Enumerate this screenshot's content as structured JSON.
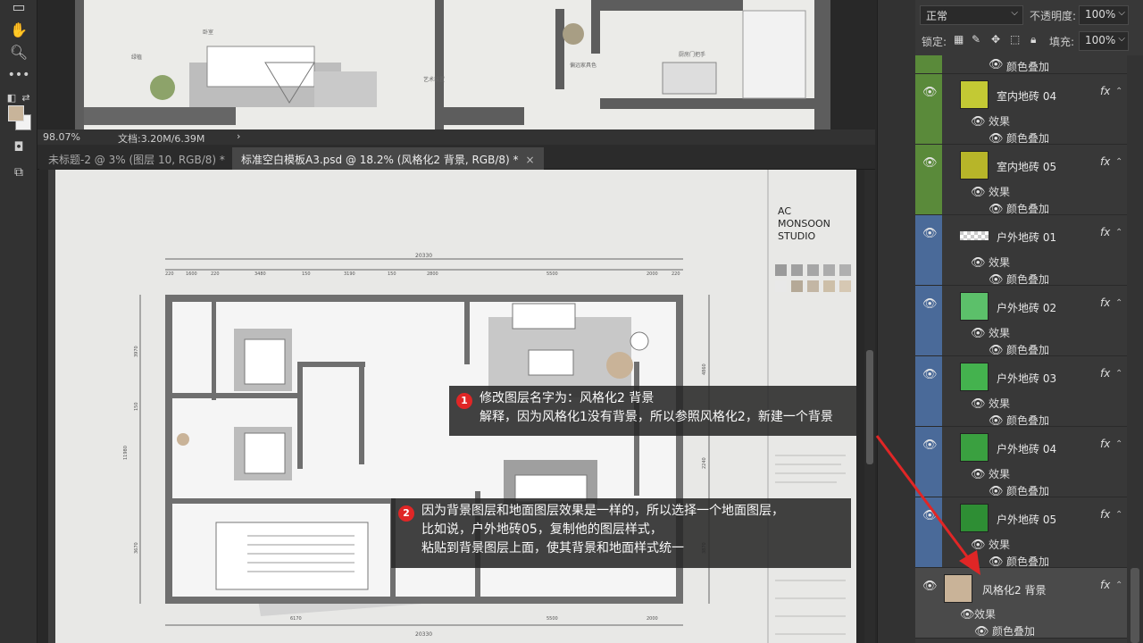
{
  "canvas_top": {
    "status_zoom": "98.07%",
    "status_doc": "文档:3.20M/6.39M",
    "status_caret": "›",
    "labels": [
      "卧室",
      "绿植",
      "艺术装置",
      "偏远家具色",
      "厨房门把手"
    ]
  },
  "tabs": [
    {
      "label": "未标题-2 @ 3% (图层 10, RGB/8) *",
      "close": "×",
      "active": false
    },
    {
      "label": "标准空白模板A3.psd @ 18.2% (风格化2 背景, RGB/8) *",
      "close": "×",
      "active": true
    }
  ],
  "drawing": {
    "studio_name": [
      "AC",
      "MONSOON",
      "STUDIO"
    ],
    "top_total": "20330",
    "bottom_total": "20330",
    "top_dims": [
      "220",
      "1600",
      "220",
      "3480",
      "150",
      "3190",
      "150",
      "2800",
      "5500",
      "2000",
      "220"
    ],
    "bottom_dims": [
      "6170",
      "5500",
      "2000"
    ],
    "left_total": "11980",
    "left_dims": [
      "3970",
      "150",
      "3670"
    ],
    "right_dims": [
      "4860",
      "2240",
      "3870"
    ]
  },
  "callouts": [
    {
      "num": "1",
      "lines": [
        "修改图层名字为：风格化2 背景",
        "解释，因为风格化1没有背景，所以参照风格化2，新建一个背景"
      ]
    },
    {
      "num": "2",
      "lines": [
        "因为背景图层和地面图层效果是一样的，所以选择一个地面图层，",
        "比如说，户外地砖05，复制他的图层样式，",
        "粘贴到背景图层上面，使其背景和地面样式统一"
      ]
    }
  ],
  "layers_panel": {
    "blend_mode": "正常",
    "opacity_label": "不透明度:",
    "opacity_value": "100%",
    "lock_label": "锁定:",
    "fill_label": "填充:",
    "fill_value": "100%",
    "top_sub": "颜色叠加",
    "effect_label": "效果",
    "overlay_label": "颜色叠加",
    "fx": "fx",
    "layers": [
      {
        "name": "室内地砖 04",
        "thumb_color": "#c3c934",
        "group_color": "#5a8a3a"
      },
      {
        "name": "室内地砖 05",
        "thumb_color": "#b7b529",
        "group_color": "#5a8a3a"
      },
      {
        "name": "户外地砖 01",
        "thumb_color": "checker",
        "group_color": "#4a6a99"
      },
      {
        "name": "户外地砖 02",
        "thumb_color": "#5cc06a",
        "group_color": "#4a6a99"
      },
      {
        "name": "户外地砖 03",
        "thumb_color": "#44b24e",
        "group_color": "#4a6a99"
      },
      {
        "name": "户外地砖 04",
        "thumb_color": "#3aa040",
        "group_color": "#4a6a99"
      },
      {
        "name": "户外地砖 05",
        "thumb_color": "#2e8e34",
        "group_color": "#4a6a99"
      },
      {
        "name": "风格化2 背景",
        "thumb_color": "#c9b398",
        "group_color": "none"
      }
    ]
  }
}
